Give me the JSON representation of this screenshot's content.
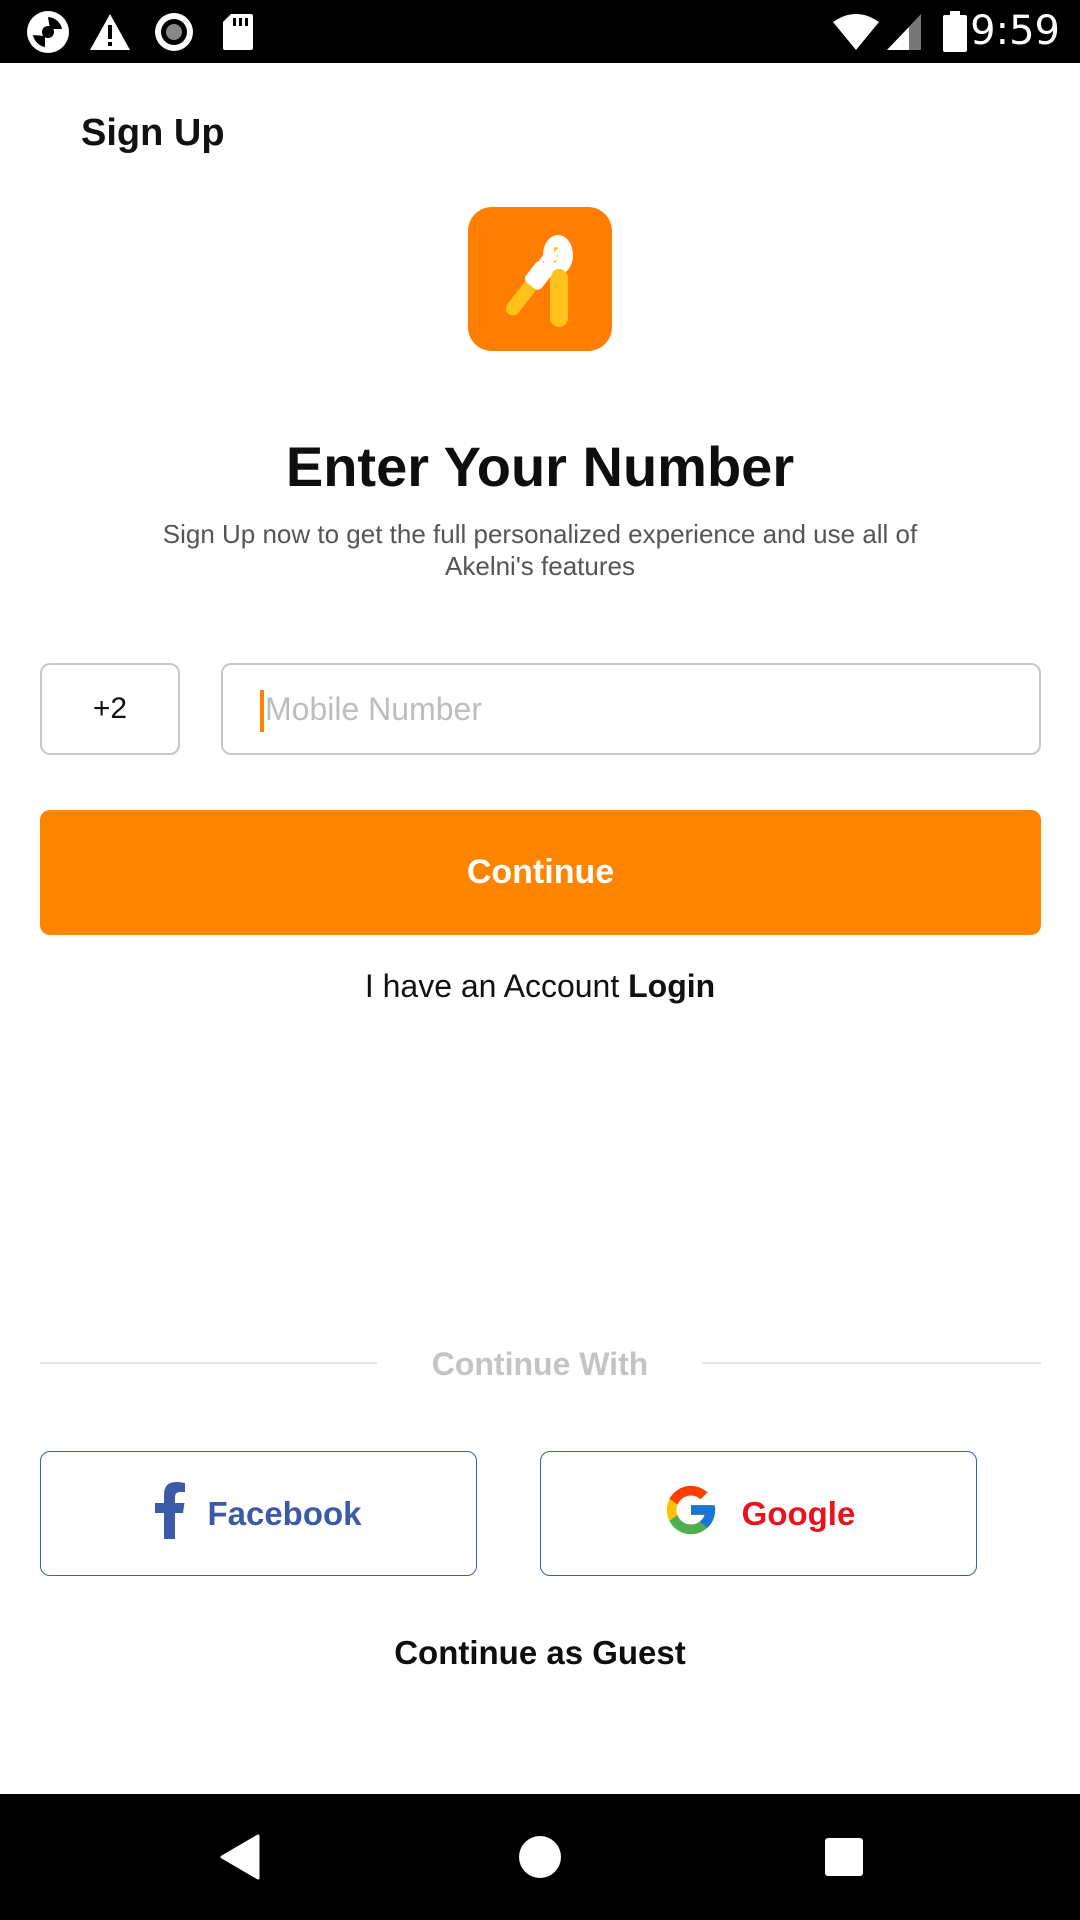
{
  "status_bar": {
    "time": "9:59",
    "icons": [
      "camera-aperture-icon",
      "warning-icon",
      "record-icon",
      "sd-card-icon",
      "wifi-icon",
      "cell-signal-icon",
      "battery-icon"
    ]
  },
  "header": {
    "title": "Sign Up"
  },
  "logo": {
    "icon": "fork-spoon-logo-icon",
    "background": "#ff7d00"
  },
  "main": {
    "heading": "Enter Your Number",
    "subtext": "Sign Up now to get the full personalized experience and use all of Akelni's features",
    "country_code": "+2",
    "mobile_placeholder": "Mobile Number",
    "mobile_value": "",
    "continue_label": "Continue",
    "account_prompt": "I have an Account",
    "login_label": "Login"
  },
  "social": {
    "heading": "Continue With",
    "facebook_label": "Facebook",
    "google_label": "Google",
    "guest_label": "Continue as Guest"
  },
  "nav_bar": {
    "icons": [
      "back-icon",
      "home-icon",
      "recents-icon"
    ]
  },
  "colors": {
    "accent": "#ff8400",
    "facebook": "#3b5ba7",
    "google_text": "#e8131d",
    "button_border": "#3e5bb2"
  }
}
